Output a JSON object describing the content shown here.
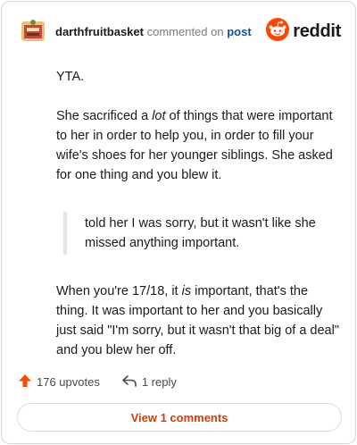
{
  "header": {
    "username": "darthfruitbasket",
    "commented_text": "commented on",
    "post_link": "post",
    "brand": "reddit"
  },
  "comment": {
    "paragraphs": [
      "YTA.",
      "She sacrificed a lot of things that were important to her in order to help you, in order to fill your wife's shoes for her younger siblings. She asked for one thing and you blew it."
    ],
    "p2_pre": "She sacrificed a ",
    "p2_em": "lot",
    "p2_post": " of things that were important to her in order to help you, in order to fill your wife's shoes for her younger siblings. She asked for one thing and you blew it.",
    "quote": "told her I was sorry, but it wasn't like she missed anything important.",
    "p3_pre": "When you're 17/18, it ",
    "p3_em": "is",
    "p3_post": " important, that's the thing. It was important to her and you basically just said \"I'm sorry, but it wasn't that big of a deal\" and you blew her off."
  },
  "actions": {
    "upvotes": "176 upvotes",
    "reply": "1 reply"
  },
  "view_button": "View 1 comments",
  "colors": {
    "accent": "#d93a00",
    "upvote": "#ff4500",
    "link": "#0a54a8"
  }
}
